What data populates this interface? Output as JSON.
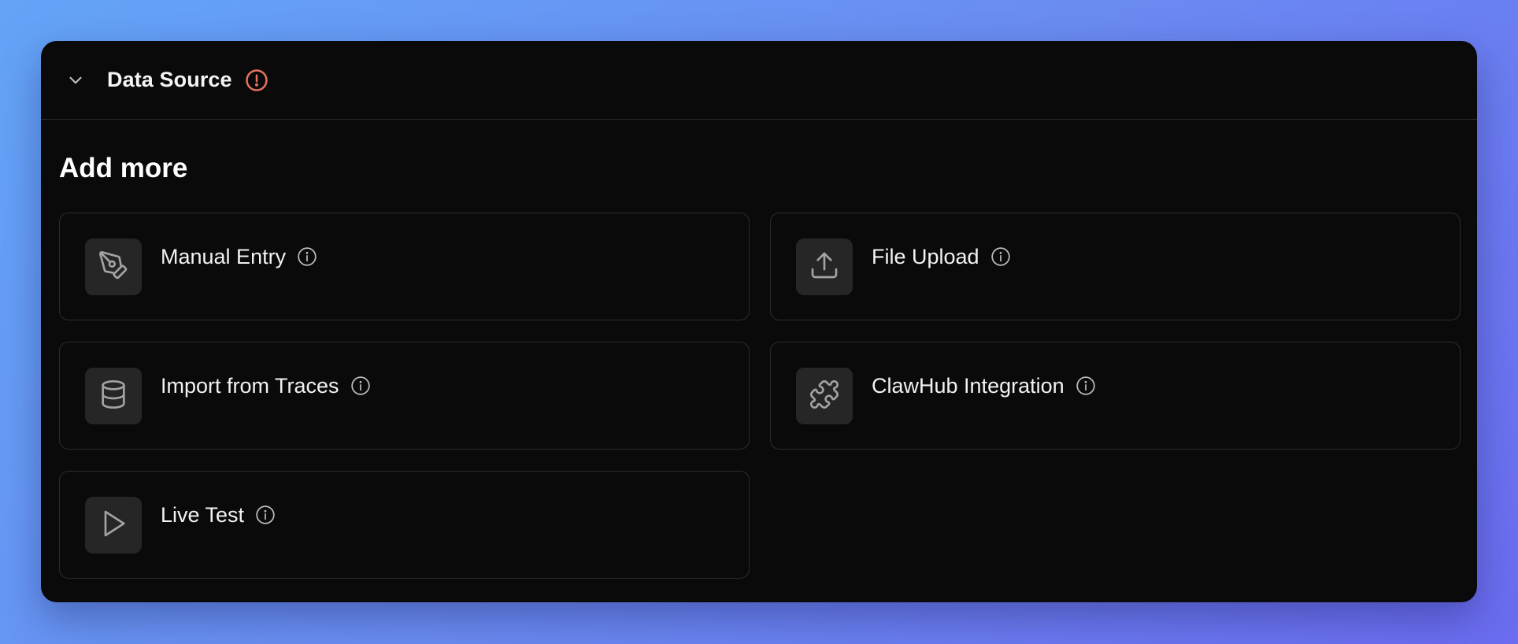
{
  "panel": {
    "title": "Data Source",
    "collapse_icon": "chevron-down-icon",
    "status_icon": "alert-circle-icon",
    "status_color": "#e5735f"
  },
  "section": {
    "title": "Add more"
  },
  "sources": [
    {
      "label": "Manual Entry",
      "icon": "pen-tool-icon"
    },
    {
      "label": "File Upload",
      "icon": "upload-icon"
    },
    {
      "label": "Import from Traces",
      "icon": "database-icon"
    },
    {
      "label": "ClawHub Integration",
      "icon": "puzzle-icon"
    },
    {
      "label": "Live Test",
      "icon": "play-icon"
    }
  ],
  "colors": {
    "panel_bg": "#0a0a0a",
    "card_border": "#2c2c2c",
    "icon_box_bg": "#262626",
    "icon_stroke": "#a3a3a3"
  }
}
